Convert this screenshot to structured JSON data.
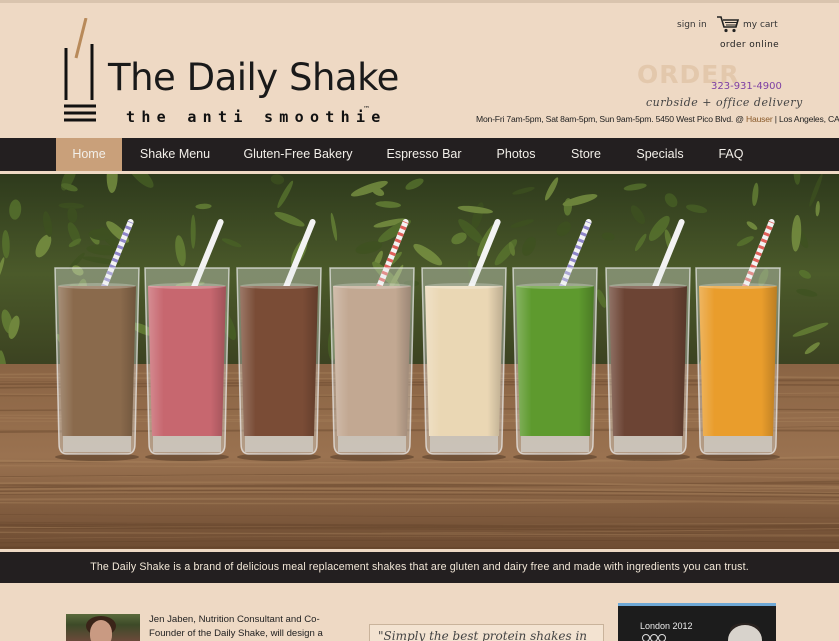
{
  "brand": {
    "name": "The Daily Shake",
    "tagline": "the anti smoothie",
    "trademark": "™"
  },
  "header": {
    "sign_in": "sign in",
    "my_cart": "my cart",
    "order_online": "order online",
    "order_label": "ORDER",
    "phone": "323-931-4900",
    "delivery": "curbside + office delivery",
    "hours": "Mon-Fri 7am-5pm,  Sat 8am-5pm,  Sun 9am-5pm.  5450 West Pico Blvd. @",
    "hours_street": "Hauser",
    "hours_city": "| Los Angeles, CA"
  },
  "nav": {
    "items": [
      {
        "label": "Home",
        "active": true
      },
      {
        "label": "Shake Menu",
        "active": false
      },
      {
        "label": "Gluten-Free Bakery",
        "active": false
      },
      {
        "label": "Espresso Bar",
        "active": false
      },
      {
        "label": "Photos",
        "active": false
      },
      {
        "label": "Store",
        "active": false
      },
      {
        "label": "Specials",
        "active": false
      },
      {
        "label": "FAQ",
        "active": false
      }
    ]
  },
  "hero": {
    "shakes": [
      {
        "color": "#8a6a4c",
        "straw": "#8f86c9"
      },
      {
        "color": "#c7676f",
        "straw": "#ffffff"
      },
      {
        "color": "#7a4c36",
        "straw": "#ffffff"
      },
      {
        "color": "#c2a892",
        "straw": "#e0605a"
      },
      {
        "color": "#ead7b4",
        "straw": "#ffffff"
      },
      {
        "color": "#5e9a2e",
        "straw": "#8f86c9"
      },
      {
        "color": "#6c4434",
        "straw": "#ffffff"
      },
      {
        "color": "#e99d2c",
        "straw": "#e0605a"
      }
    ]
  },
  "intro": {
    "text": "The Daily Shake is a brand of delicious meal replacement shakes that are gluten and dairy free and made with ingredients you can trust."
  },
  "content": {
    "jen_line1": "Jen Jaben, Nutrition Consultant and Co-",
    "jen_line2": "Founder of the Daily Shake, will design a",
    "quote": "\"Simply the best protein shakes in",
    "london": "London 2012"
  },
  "colors": {
    "nav_bg": "#231f20",
    "nav_active": "#c9a07a",
    "page_bg": "#eed9c4",
    "phone": "#7d3fa3"
  }
}
